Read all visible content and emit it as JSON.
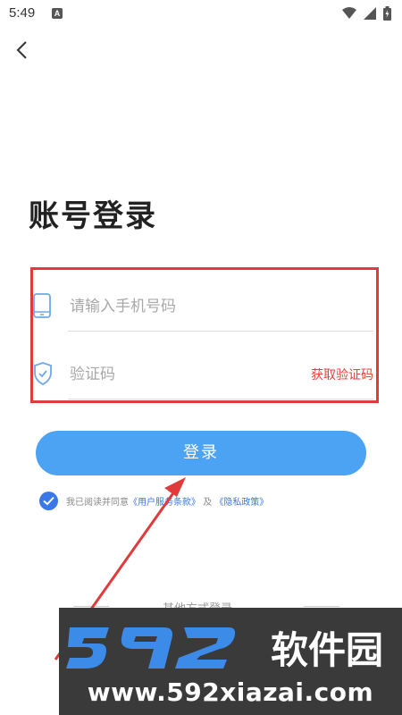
{
  "status_bar": {
    "time": "5:49",
    "notification_icon": "A"
  },
  "page": {
    "title": "账号登录"
  },
  "form": {
    "phone_placeholder": "请输入手机号码",
    "code_placeholder": "验证码",
    "get_code_label": "获取验证码",
    "login_label": "登录"
  },
  "agreement": {
    "prefix": "我已阅读并同意",
    "terms_link": "《用户服务条款》",
    "connector": "及",
    "privacy_link": "《隐私政策》",
    "checked": true
  },
  "other_login": {
    "label": "其他方式登录"
  },
  "watermark": {
    "logo_text": "592软件园",
    "url": "www.592xiazai.com"
  },
  "colors": {
    "accent": "#4da3f3",
    "link": "#3a78e8",
    "highlight": "#e03a3a",
    "get_code": "#e6423a"
  }
}
